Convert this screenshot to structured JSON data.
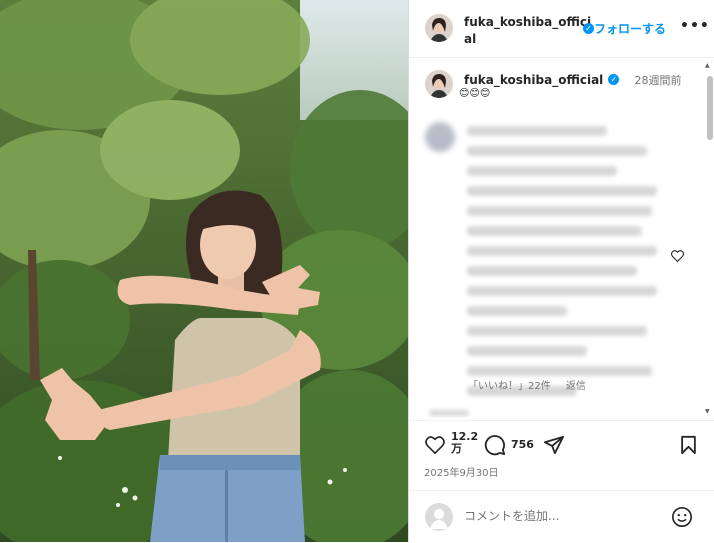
{
  "post": {
    "username": "fuka_koshiba_official",
    "username_line1": "fuka_koshiba_offici",
    "username_line2": "al",
    "follow_label": "フォローする",
    "more_label": "•••",
    "image_alt": "photo-post"
  },
  "caption": {
    "username": "fuka_koshiba_official",
    "time": "28週間前",
    "text": "😊😊😊"
  },
  "comment": {
    "likes_label": "「いいね！」22件",
    "reply_label": "返信"
  },
  "actions": {
    "like_count_line1": "12.2",
    "like_count_line2": "万",
    "comment_count": "756",
    "date": "2025年9月30日"
  },
  "comment_input": {
    "placeholder": "コメントを追加..."
  },
  "colors": {
    "accent": "#0095f6",
    "border": "#dbdbdb",
    "muted": "#737373"
  },
  "icons": [
    "verified-badge-icon",
    "more-options-icon",
    "heart-icon",
    "comment-icon",
    "share-icon",
    "bookmark-icon",
    "emoji-icon",
    "avatar"
  ]
}
